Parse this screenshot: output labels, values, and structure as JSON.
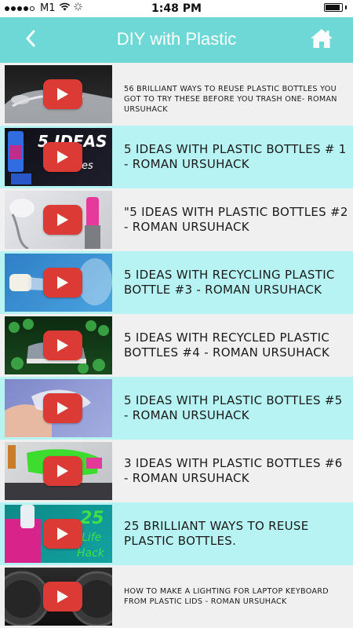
{
  "status_bar": {
    "carrier": "M1",
    "time": "1:48 PM",
    "signal_bars_filled": 4,
    "signal_bars_total": 5,
    "battery_level": 0.9
  },
  "header": {
    "title": "DIY with Plastic",
    "background_color": "#6dd8d6",
    "back_icon": "chevron-left-icon",
    "home_icon": "home-icon"
  },
  "colors": {
    "row_light": "#f0f0f0",
    "row_cyan": "#b6f3f2",
    "play_button": "#db3a35"
  },
  "videos": [
    {
      "title": "56 BRILLIANT WAYS TO REUSE PLASTIC BOTTLES YOU GOT TO TRY THESE BEFORE YOU TRASH ONE- ROMAN URSUHACK",
      "thumbnail_text": ""
    },
    {
      "title": "5 IDEAS WITH PLASTIC BOTTLES # 1 - ROMAN URSUHACK",
      "thumbnail_text": "5 IDEAS with plastic bottles"
    },
    {
      "title": "\"5 IDEAS WITH PLASTIC BOTTLES #2 - ROMAN URSUHACK",
      "thumbnail_text": ""
    },
    {
      "title": "5 IDEAS WITH RECYCLING PLASTIC BOTTLE #3 - ROMAN URSUHACK",
      "thumbnail_text": ""
    },
    {
      "title": "5 IDEAS WITH RECYCLED PLASTIC BOTTLES #4 - ROMAN URSUHACK",
      "thumbnail_text": ""
    },
    {
      "title": "5 IDEAS WITH PLASTIC BOTTLES #5 - ROMAN URSUHACK",
      "thumbnail_text": ""
    },
    {
      "title": "3 IDEAS WITH PLASTIC BOTTLES #6 - ROMAN URSUHACK",
      "thumbnail_text": ""
    },
    {
      "title": "25 BRILLIANT WAYS TO REUSE PLASTIC BOTTLES.",
      "thumbnail_text": "25 Life Hack"
    },
    {
      "title": "HOW TO MAKE A LIGHTING FOR LAPTOP KEYBOARD FROM PLASTIC LIDS - ROMAN URSUHACK",
      "thumbnail_text": ""
    }
  ]
}
